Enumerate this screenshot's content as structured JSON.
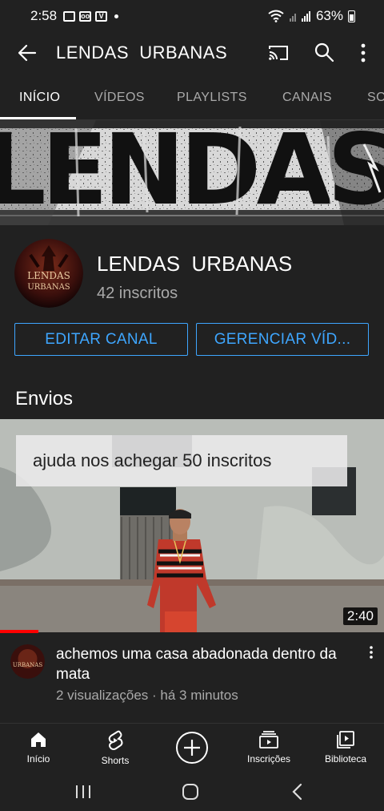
{
  "status_bar": {
    "time": "2:58",
    "battery": "63%"
  },
  "app_bar": {
    "title": "LENDAS  URBANAS"
  },
  "tabs": [
    {
      "label": "INÍCIO",
      "active": true
    },
    {
      "label": "VÍDEOS"
    },
    {
      "label": "PLAYLISTS"
    },
    {
      "label": "CANAIS"
    },
    {
      "label": "SO"
    }
  ],
  "banner": {
    "text": "LENDAS"
  },
  "channel": {
    "name": "LENDAS  URBANAS",
    "subscribers": "42 inscritos",
    "avatar_text_1": "LENDAS",
    "avatar_text_2": "URBANAS"
  },
  "actions": {
    "edit": "EDITAR CANAL",
    "manage": "GERENCIAR VÍD..."
  },
  "uploads": {
    "section_title": "Envios",
    "video": {
      "thumbnail_caption": "ajuda nos achegar 50 inscritos",
      "duration": "2:40",
      "watch_progress": 0.1,
      "title": "achemos uma casa abadonada dentro da mata",
      "meta": "2 visualizações · há 3 minutos"
    }
  },
  "bottom_nav": [
    {
      "label": "Início",
      "icon": "home-icon"
    },
    {
      "label": "Shorts",
      "icon": "shorts-icon"
    },
    {
      "label": "",
      "icon": "create-icon"
    },
    {
      "label": "Inscrições",
      "icon": "subscriptions-icon"
    },
    {
      "label": "Biblioteca",
      "icon": "library-icon"
    }
  ],
  "colors": {
    "background": "#212121",
    "accent": "#3ea6ff",
    "secondary_text": "#aaaaaa",
    "progress": "#ff0000"
  }
}
